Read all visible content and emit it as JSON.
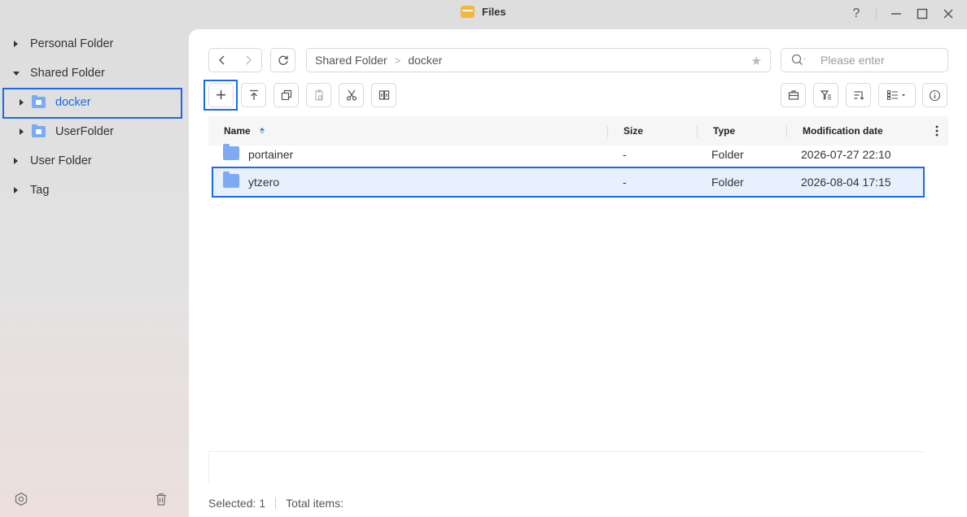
{
  "window": {
    "title": "Files",
    "help_glyph": "?",
    "min_glyph": "—",
    "close_glyph": "✕"
  },
  "sidebar": {
    "items": [
      {
        "label": "Personal Folder"
      },
      {
        "label": "Shared Folder"
      },
      {
        "label": "docker",
        "selected": true
      },
      {
        "label": "UserFolder"
      },
      {
        "label": "User Folder"
      },
      {
        "label": "Tag"
      }
    ]
  },
  "toolbar": {
    "breadcrumb": [
      "Shared Folder",
      "docker"
    ],
    "breadcrumb_sep": ">",
    "search_placeholder": "Please enter",
    "new_glyph": "+"
  },
  "table": {
    "columns": [
      "Name",
      "Size",
      "Type",
      "Modification date"
    ],
    "rows": [
      {
        "name": "portainer",
        "size": "-",
        "type": "Folder",
        "modified": "2026-07-27 22:10"
      },
      {
        "name": "ytzero",
        "size": "-",
        "type": "Folder",
        "modified": "2026-08-04 17:15",
        "selected": true
      }
    ]
  },
  "status": {
    "selected_label": "Selected:",
    "selected_count": "1",
    "total_label": "Total items:"
  },
  "colors": {
    "accent": "#1a6aea",
    "folder": "#7cabf5",
    "selected_row": "#e7f0fd",
    "app_icon": "#f4b73b"
  }
}
